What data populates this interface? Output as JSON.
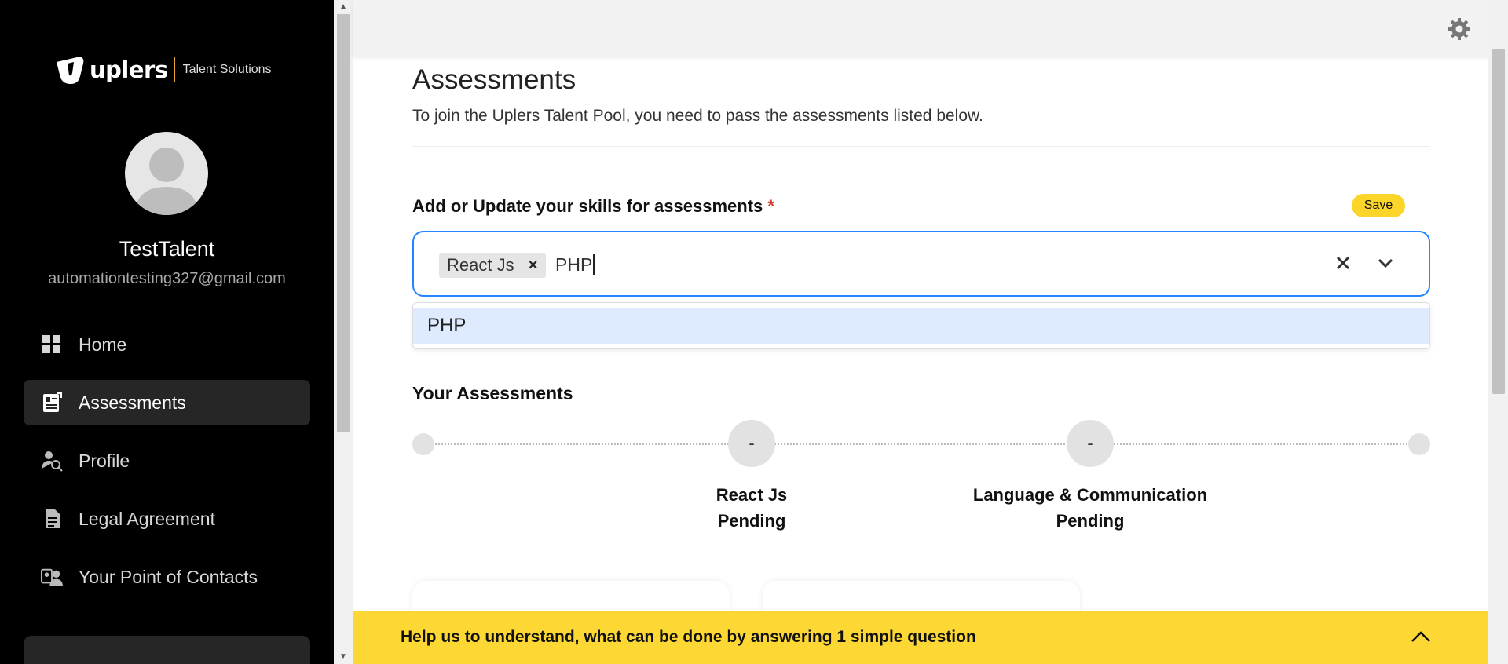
{
  "brand": {
    "name": "uplers",
    "tagline": "Talent Solutions"
  },
  "user": {
    "name": "TestTalent",
    "email": "automationtesting327@gmail.com"
  },
  "nav": [
    {
      "label": "Home",
      "icon": "grid-icon",
      "active": false
    },
    {
      "label": "Assessments",
      "icon": "assessment-icon",
      "active": true
    },
    {
      "label": "Profile",
      "icon": "profile-search-icon",
      "active": false
    },
    {
      "label": "Legal Agreement",
      "icon": "document-icon",
      "active": false
    },
    {
      "label": "Your Point of Contacts",
      "icon": "contacts-icon",
      "active": false
    }
  ],
  "page": {
    "title": "Assessments",
    "subtitle": "To join the Uplers Talent Pool, you need to pass the assessments listed below."
  },
  "skills": {
    "label": "Add or Update your skills for assessments",
    "required_mark": "*",
    "save_label": "Save",
    "selected": [
      "React Js"
    ],
    "remove_symbol": "×",
    "input_value": "PHP",
    "options": [
      "PHP"
    ]
  },
  "assessments": {
    "heading": "Your Assessments",
    "items": [
      {
        "name": "React Js",
        "status": "Pending",
        "score": "-"
      },
      {
        "name": "Language & Communication",
        "status": "Pending",
        "score": "-"
      }
    ]
  },
  "banner": {
    "text": "Help us to understand, what can be done by answering 1 simple question"
  },
  "colors": {
    "accent_yellow": "#fdd835",
    "focus_blue": "#2684ff",
    "option_highlight": "#deebff",
    "sidebar_bg": "#000000"
  }
}
